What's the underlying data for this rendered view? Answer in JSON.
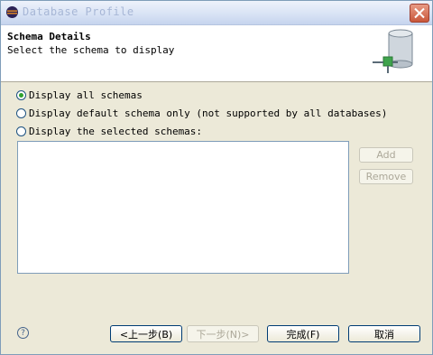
{
  "window": {
    "title": "Database Profile"
  },
  "header": {
    "title": "Schema Details",
    "description": "Select the schema to display"
  },
  "options": [
    {
      "label": "Display all schemas",
      "checked": true
    },
    {
      "label": "Display default schema only (not supported by all databases)",
      "checked": false
    },
    {
      "label": "Display the selected schemas:",
      "checked": false
    }
  ],
  "side_buttons": {
    "add": "Add",
    "remove": "Remove"
  },
  "footer": {
    "back": "<上一步(B)",
    "next": "下一步(N)>",
    "finish": "完成(F)",
    "cancel": "取消"
  },
  "icons": {
    "app": "eclipse-icon",
    "close": "close-icon",
    "db": "database-icon",
    "help": "help-icon"
  }
}
